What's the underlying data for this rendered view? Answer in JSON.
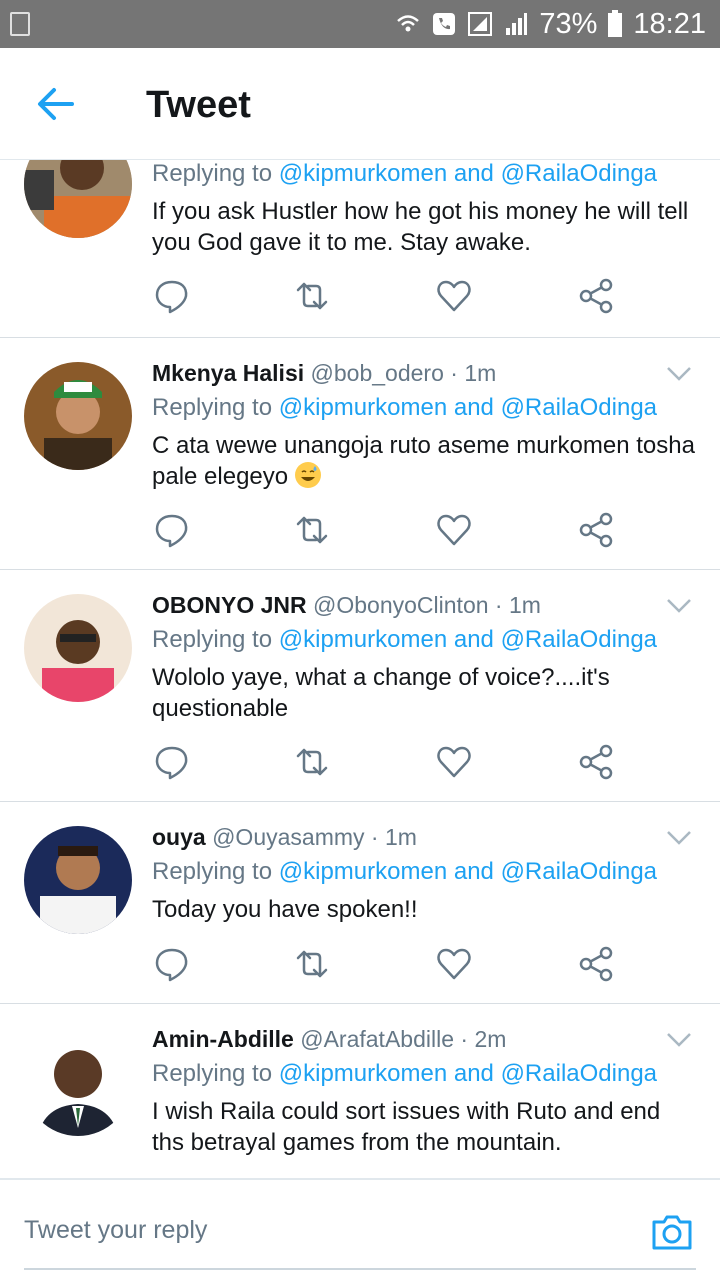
{
  "status_bar": {
    "battery": "73%",
    "time": "18:21"
  },
  "app_bar": {
    "title": "Tweet"
  },
  "tweets": [
    {
      "name": "",
      "handle": "",
      "time": "",
      "reply_prefix": "Replying to",
      "reply_to_1": "@kipmurkomen",
      "reply_and": "and",
      "reply_to_2": "@RailaOdinga",
      "text_line_1": "If you ask Hustler how he got his money he will tell",
      "text_line_2": "you God gave it to me. Stay awake."
    },
    {
      "name": "Mkenya Halisi",
      "handle": "@bob_odero",
      "time": "· 1m",
      "reply_prefix": "Replying to",
      "reply_to_1": "@kipmurkomen",
      "reply_and": "and",
      "reply_to_2": "@RailaOdinga",
      "text_line_1": "C ata wewe unangoja ruto aseme murkomen tosha",
      "text_line_2": "pale elegeyo",
      "emoji": "grinning-face-with-sweat"
    },
    {
      "name": "OBONYO JNR",
      "handle": "@ObonyoClinton",
      "time": "· 1m",
      "reply_prefix": "Replying to",
      "reply_to_1": "@kipmurkomen",
      "reply_and": "and",
      "reply_to_2": "@RailaOdinga",
      "text_line_1": "Wololo yaye, what a change of voice?....it's",
      "text_line_2": "questionable"
    },
    {
      "name": "ouya",
      "handle": "@Ouyasammy",
      "time": "· 1m",
      "reply_prefix": "Replying to",
      "reply_to_1": "@kipmurkomen",
      "reply_and": "and",
      "reply_to_2": "@RailaOdinga",
      "text_line_1": "Today you have spoken!!"
    },
    {
      "name": "Amin-Abdille",
      "handle": "@ArafatAbdille",
      "time": "· 2m",
      "reply_prefix": "Replying to",
      "reply_to_1": "@kipmurkomen",
      "reply_and": "and",
      "reply_to_2": "@RailaOdinga",
      "text_line_1": "I wish Raila could sort issues with Ruto and end",
      "text_line_2": "ths betrayal games from the mountain."
    }
  ],
  "composer": {
    "placeholder": "Tweet your reply"
  },
  "colors": {
    "accent": "#1da1f2",
    "text": "#14171a",
    "muted": "#657786",
    "status_bar": "#757575"
  }
}
